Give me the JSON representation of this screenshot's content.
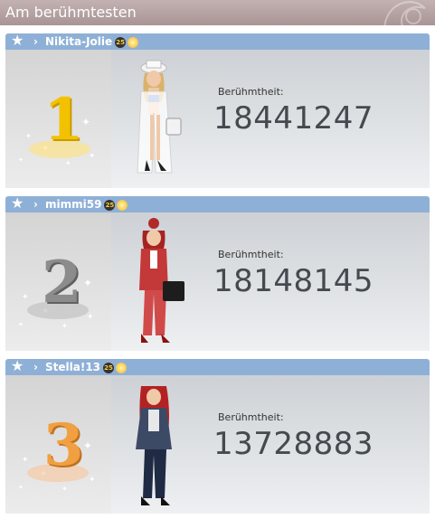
{
  "header": {
    "title": "Am berühmtesten"
  },
  "entries": [
    {
      "rank": "1",
      "username": "Nikita-Jolie",
      "level": "25",
      "fame_label": "Berühmtheit:",
      "fame_value": "18441247",
      "rank_color": "#f2c200"
    },
    {
      "rank": "2",
      "username": "mimmi59",
      "level": "25",
      "fame_label": "Berühmtheit:",
      "fame_value": "18148145",
      "rank_color": "#8c8c8c"
    },
    {
      "rank": "3",
      "username": "Stella!13",
      "level": "25",
      "fame_label": "Berühmtheit:",
      "fame_value": "13728883",
      "rank_color": "#f0a040"
    }
  ]
}
